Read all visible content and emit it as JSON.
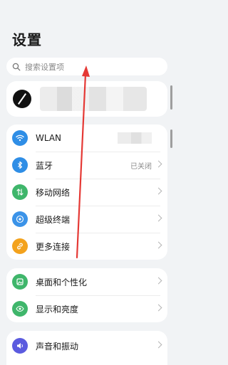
{
  "header": {
    "title": "设置"
  },
  "search": {
    "placeholder": "搜索设置项"
  },
  "colors": {
    "wlan": "#2f8ee6",
    "bluetooth": "#2f8ee6",
    "mobile": "#3fb66b",
    "terminal": "#3b93e8",
    "more": "#f3a21d",
    "desktop": "#3fb66b",
    "display": "#3fb66b",
    "sound": "#5b5bdf",
    "annotation_arrow": "#e53935"
  },
  "group1": {
    "items": [
      {
        "label": "WLAN",
        "icon": "wifi-icon"
      },
      {
        "label": "蓝牙",
        "value": "已关闭",
        "icon": "bluetooth-icon"
      },
      {
        "label": "移动网络",
        "icon": "mobile-network-icon"
      },
      {
        "label": "超级终端",
        "icon": "super-terminal-icon"
      },
      {
        "label": "更多连接",
        "icon": "link-icon"
      }
    ]
  },
  "group2": {
    "items": [
      {
        "label": "桌面和个性化",
        "icon": "desktop-icon"
      },
      {
        "label": "显示和亮度",
        "icon": "eye-icon"
      }
    ]
  },
  "group3": {
    "items": [
      {
        "label": "声音和振动",
        "icon": "speaker-icon"
      }
    ]
  }
}
